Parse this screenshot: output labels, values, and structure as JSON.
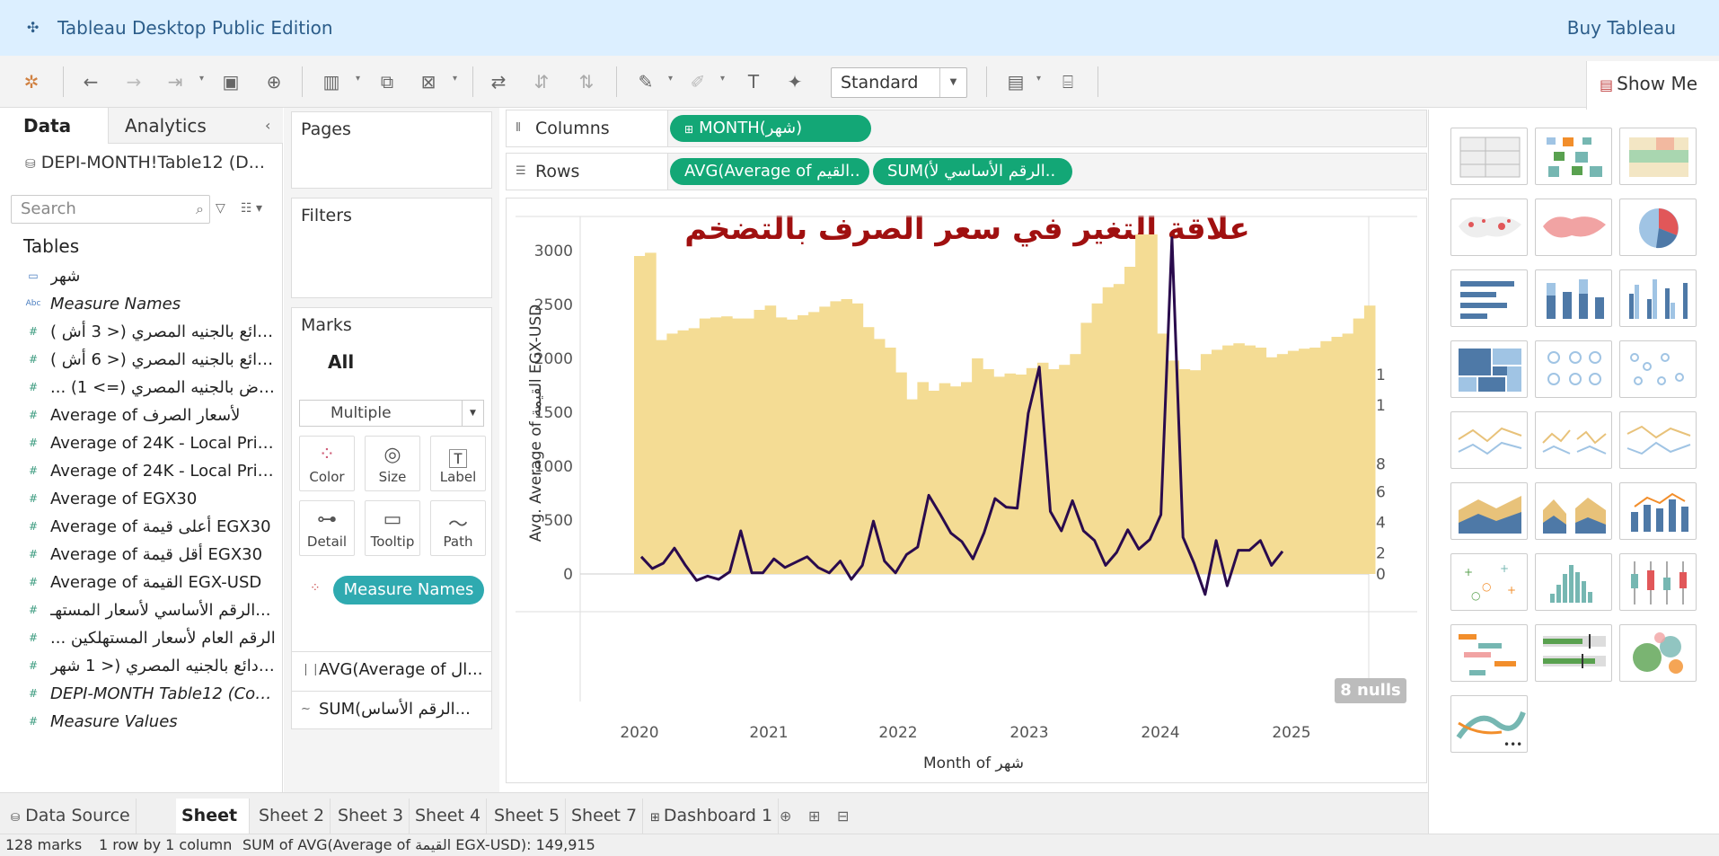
{
  "app": {
    "title": "Tableau Desktop Public Edition",
    "buy": "Buy Tableau"
  },
  "toolbar": {
    "mark_size_select": "Standard",
    "show_me": "Show Me"
  },
  "data_pane": {
    "tab_data": "Data",
    "tab_analytics": "Analytics",
    "datasource": "DEPI-MONTH!Table12 (D...",
    "search_placeholder": "Search",
    "tables_header": "Tables",
    "fields": [
      {
        "type": "date",
        "label": "شهر",
        "italic": false
      },
      {
        "type": "abc",
        "label": "Measure Names",
        "italic": true
      },
      {
        "type": "num",
        "label": "ودائع بالجنيه المصري (< 3 أش )...",
        "italic": false
      },
      {
        "type": "num",
        "label": "ودائع بالجنيه المصري (< 6 أش )...",
        "italic": false
      },
      {
        "type": "num",
        "label": "... قروض بالجنيه المصري (=> 1)",
        "italic": false
      },
      {
        "type": "num",
        "label": "Average of  لأسعار الصرف",
        "italic": false
      },
      {
        "type": "num",
        "label": "Average of 24K - Local Pric...",
        "italic": false
      },
      {
        "type": "num",
        "label": "Average of 24K - Local Pric...",
        "italic": false
      },
      {
        "type": "num",
        "label": "Average of EGX30",
        "italic": false
      },
      {
        "type": "num",
        "label": "Average of أعلى قيمة EGX30",
        "italic": false
      },
      {
        "type": "num",
        "label": "Average of أقل قيمة EGX30",
        "italic": false
      },
      {
        "type": "num",
        "label": "Average of القيمة EGX-USD",
        "italic": false
      },
      {
        "type": "num",
        "label": "الرقم الأساسي لأسعار المستهـ...",
        "italic": false
      },
      {
        "type": "num",
        "label": "... الرقم العام لأسعار المستهلكين",
        "italic": false
      },
      {
        "type": "num",
        "label": "ودائع بالجنيه المصري (< 1 شهر...",
        "italic": false
      },
      {
        "type": "num",
        "label": "DEPI-MONTH Table12 (Cou...",
        "italic": true
      },
      {
        "type": "num",
        "label": "Measure Values",
        "italic": true
      }
    ]
  },
  "cards": {
    "pages": "Pages",
    "filters": "Filters",
    "marks": "Marks",
    "all": "All",
    "mark_type": "Multiple",
    "buttons": [
      "Color",
      "Size",
      "Label",
      "Detail",
      "Tooltip",
      "Path"
    ],
    "measure_names_pill": "Measure Names",
    "shelf_avg": "AVG(Average of ال...",
    "shelf_sum": "SUM(الرقم الأساس..."
  },
  "shelves": {
    "columns_label": "Columns",
    "rows_label": "Rows",
    "columns_pill": "MONTH(شهر)",
    "rows_pill1": "AVG(Average of القيم..",
    "rows_pill2": "SUM(الرقم الأساسي لأ.."
  },
  "chart_data": {
    "type": "bar",
    "title": "علاقة التغير في سعر الصرف بالتضخم",
    "xlabel": "Month of شهر",
    "ylabel": "Avg. Average of القيمة EGX-USD",
    "x_ticks": [
      "2020",
      "2021",
      "2022",
      "2023",
      "2024",
      "2025"
    ],
    "y_ticks": [
      "3000",
      "2500",
      "2000",
      "1500",
      "1000",
      "500",
      "0"
    ],
    "right_ticks": [
      "1",
      "1",
      "8",
      "6",
      "4",
      "2",
      "0"
    ],
    "ylim": [
      -350,
      3300
    ],
    "series": [
      {
        "name": "AVG(Average of القيمة EGX-USD)",
        "kind": "bar",
        "color": "#f4dc94",
        "values": [
          2950,
          2980,
          2170,
          2230,
          2260,
          2280,
          2370,
          2380,
          2390,
          2370,
          2370,
          2450,
          2490,
          2380,
          2360,
          2400,
          2430,
          2480,
          2530,
          2550,
          2510,
          2290,
          2180,
          2100,
          1870,
          1620,
          1780,
          1700,
          1770,
          1740,
          1780,
          2000,
          1900,
          1830,
          1860,
          1850,
          1910,
          1960,
          1900,
          1940,
          2040,
          2330,
          2510,
          2660,
          2690,
          2850,
          3150,
          3150,
          2230,
          1980,
          1900,
          1890,
          2040,
          2080,
          2120,
          2140,
          2120,
          2100,
          2010,
          2040,
          2070,
          2090,
          2100,
          2160,
          2200,
          2230,
          2370,
          2490
        ]
      },
      {
        "name": "SUM(الرقم الأساسي لأسعار المستهلكين)",
        "kind": "line",
        "color": "#2a0b4d",
        "values": [
          160,
          50,
          100,
          240,
          80,
          -60,
          -20,
          -50,
          20,
          400,
          10,
          10,
          140,
          60,
          110,
          160,
          60,
          10,
          120,
          -50,
          80,
          490,
          120,
          10,
          180,
          250,
          730,
          560,
          380,
          300,
          140,
          380,
          700,
          620,
          610,
          1490,
          1920,
          580,
          400,
          680,
          400,
          310,
          80,
          200,
          410,
          230,
          320,
          550,
          3120,
          340,
          100,
          -190,
          310,
          -110,
          220,
          220,
          310,
          80,
          210
        ]
      }
    ],
    "nulls_badge": "8 nulls"
  },
  "sheet_tabs": [
    "Data Source",
    "Sheet 1",
    "Sheet 2",
    "Sheet 3",
    "Sheet 4",
    "Sheet 5",
    "Sheet 7",
    "Dashboard 1"
  ],
  "status": {
    "marks": "128 marks",
    "rows": "1 row by 1 column",
    "sum": "SUM of AVG(Average of القيمة EGX-USD): 149,915"
  }
}
